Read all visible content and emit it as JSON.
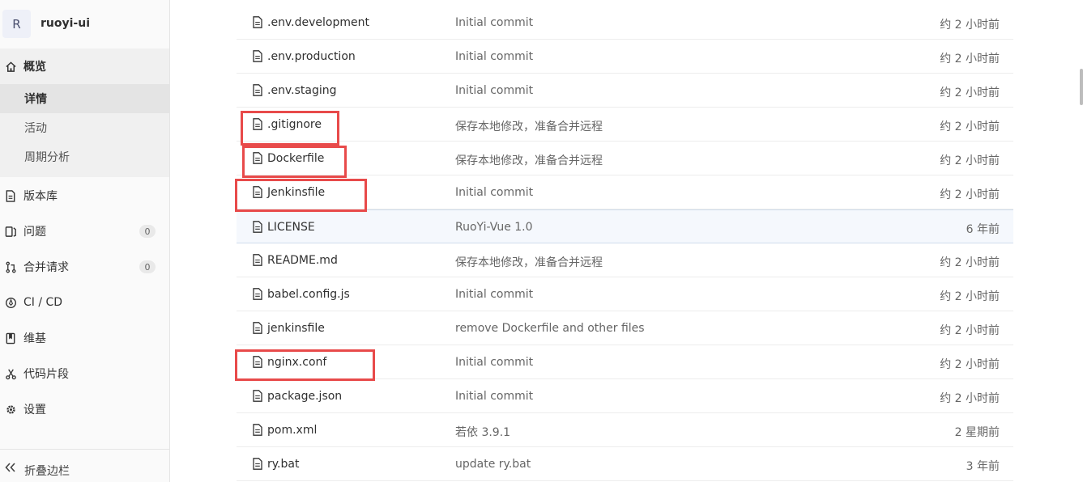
{
  "project": {
    "avatar_letter": "R",
    "name": "ruoyi-ui"
  },
  "nav": {
    "overview": "概览",
    "sub": {
      "details": "详情",
      "activity": "活动",
      "cycle": "周期分析"
    },
    "repo": "版本库",
    "issues": "问题",
    "issues_count": "0",
    "merge": "合并请求",
    "merge_count": "0",
    "cicd": "CI / CD",
    "wiki": "维基",
    "snippets": "代码片段",
    "settings": "设置",
    "collapse": "折叠边栏"
  },
  "files": [
    {
      "name": ".env.development",
      "msg": "Initial commit",
      "time": "约 2 小时前"
    },
    {
      "name": ".env.production",
      "msg": "Initial commit",
      "time": "约 2 小时前"
    },
    {
      "name": ".env.staging",
      "msg": "Initial commit",
      "time": "约 2 小时前"
    },
    {
      "name": ".gitignore",
      "msg": "保存本地修改，准备合并远程",
      "time": "约 2 小时前"
    },
    {
      "name": "Dockerfile",
      "msg": "保存本地修改，准备合并远程",
      "time": "约 2 小时前"
    },
    {
      "name": "Jenkinsfile",
      "msg": "Initial commit",
      "time": "约 2 小时前"
    },
    {
      "name": "LICENSE",
      "msg": "RuoYi-Vue 1.0",
      "time": "6 年前"
    },
    {
      "name": "README.md",
      "msg": "保存本地修改，准备合并远程",
      "time": "约 2 小时前"
    },
    {
      "name": "babel.config.js",
      "msg": "Initial commit",
      "time": "约 2 小时前"
    },
    {
      "name": "jenkinsfile",
      "msg": "remove Dockerfile and other files",
      "time": "约 2 小时前"
    },
    {
      "name": "nginx.conf",
      "msg": "Initial commit",
      "time": "约 2 小时前"
    },
    {
      "name": "package.json",
      "msg": "Initial commit",
      "time": "约 2 小时前"
    },
    {
      "name": "pom.xml",
      "msg": "若依 3.9.1",
      "time": "2 星期前"
    },
    {
      "name": "ry.bat",
      "msg": "update ry.bat",
      "time": "3 年前"
    }
  ]
}
